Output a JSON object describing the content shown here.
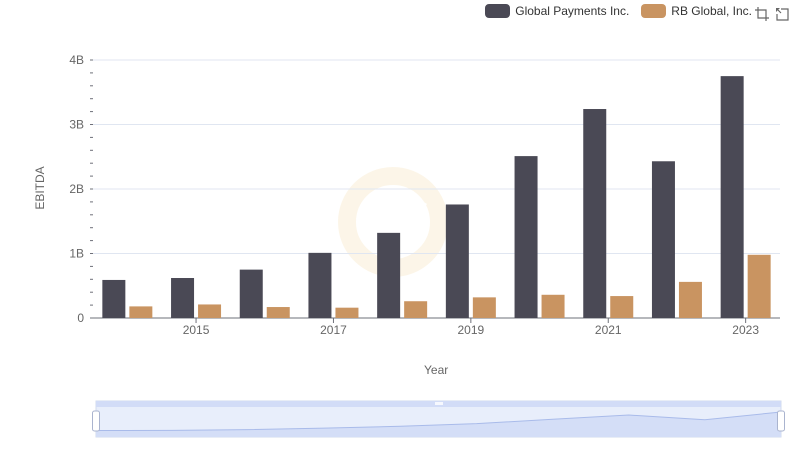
{
  "legend": {
    "items": [
      {
        "label": "Global Payments Inc.",
        "color": "#4a4955"
      },
      {
        "label": "RB Global, Inc.",
        "color": "#c99461"
      }
    ]
  },
  "toolbox": {
    "icons": [
      "zoom-icon",
      "restore-icon"
    ]
  },
  "chart_data": {
    "type": "bar",
    "xlabel": "Year",
    "ylabel": "EBITDA",
    "categories": [
      "2014",
      "2015",
      "2016",
      "2017",
      "2018",
      "2019",
      "2020",
      "2021",
      "2022",
      "2023"
    ],
    "x_tick_labels": [
      "2015",
      "2017",
      "2019",
      "2021",
      "2023"
    ],
    "y_ticks": [
      {
        "value": 0,
        "label": "0"
      },
      {
        "value": 1000000000,
        "label": "1B"
      },
      {
        "value": 2000000000,
        "label": "2B"
      },
      {
        "value": 3000000000,
        "label": "3B"
      },
      {
        "value": 4000000000,
        "label": "4B"
      }
    ],
    "ylim": [
      0,
      4000000000
    ],
    "grid": true,
    "legend_position": "top-right",
    "series": [
      {
        "name": "Global Payments Inc.",
        "color": "#4a4955",
        "values": [
          590000000,
          620000000,
          750000000,
          1010000000,
          1320000000,
          1760000000,
          2510000000,
          3240000000,
          2430000000,
          3750000000
        ]
      },
      {
        "name": "RB Global, Inc.",
        "color": "#c99461",
        "values": [
          180000000,
          210000000,
          170000000,
          160000000,
          260000000,
          320000000,
          360000000,
          340000000,
          560000000,
          980000000
        ]
      }
    ],
    "data_zoom": {
      "type": "slider",
      "range": [
        0,
        100
      ]
    }
  }
}
